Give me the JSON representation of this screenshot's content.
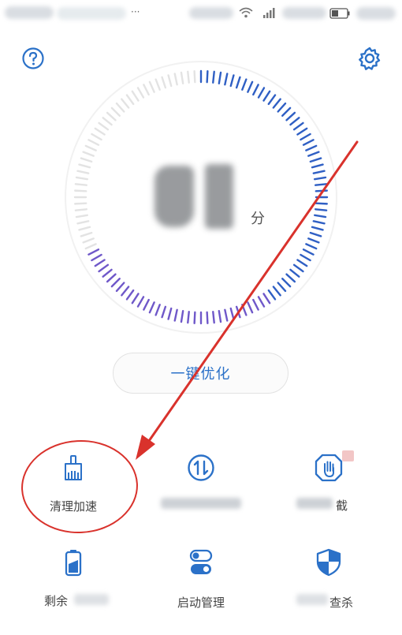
{
  "header": {
    "help_icon": "question-circle-icon",
    "settings_icon": "gear-icon"
  },
  "gauge": {
    "score_unit": "分"
  },
  "optimize_button": {
    "label": "一键优化"
  },
  "features": [
    {
      "label": "清理加速",
      "icon": "broom-icon",
      "annotated": true
    },
    {
      "label": "",
      "icon": "data-transfer-icon"
    },
    {
      "label": "截",
      "icon": "hand-shield-icon"
    },
    {
      "label": "剩余",
      "icon": "battery-icon"
    },
    {
      "label": "启动管理",
      "icon": "toggle-switch-icon"
    },
    {
      "label": "查杀",
      "icon": "shield-icon"
    }
  ],
  "colors": {
    "accent": "#2b71c8",
    "gauge_blue": "#2f5fc4",
    "gauge_purple": "#6f58c9",
    "gauge_gray": "#e3e3e3",
    "annotation": "#d9322c"
  }
}
